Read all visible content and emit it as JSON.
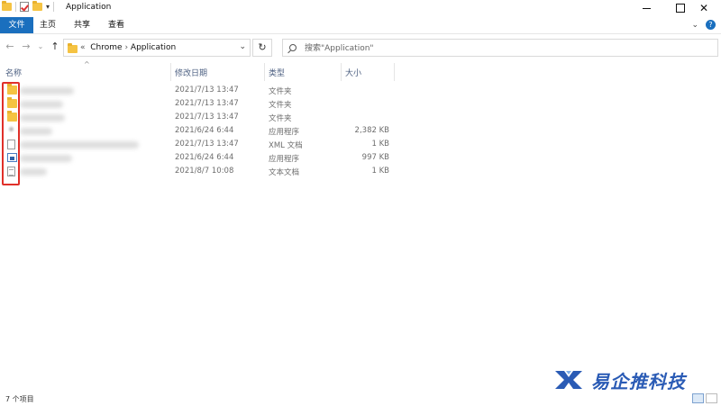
{
  "window": {
    "title": "Application"
  },
  "ribbon": {
    "tabs": [
      "文件",
      "主页",
      "共享",
      "查看"
    ]
  },
  "address_bar": {
    "prefix": "«",
    "crumbs": [
      "Chrome",
      "Application"
    ],
    "separator": "›"
  },
  "search": {
    "placeholder": "搜索\"Application\""
  },
  "columns": {
    "name": "名称",
    "date": "修改日期",
    "type": "类型",
    "size": "大小"
  },
  "files": [
    {
      "icon": "folder-icon",
      "date": "2021/7/13 13:47",
      "type": "文件夹",
      "size": ""
    },
    {
      "icon": "folder-icon",
      "date": "2021/7/13 13:47",
      "type": "文件夹",
      "size": ""
    },
    {
      "icon": "folder-icon",
      "date": "2021/7/13 13:47",
      "type": "文件夹",
      "size": ""
    },
    {
      "icon": "application-icon",
      "date": "2021/6/24 6:44",
      "type": "应用程序",
      "size": "2,382 KB"
    },
    {
      "icon": "xml-document-icon",
      "date": "2021/7/13 13:47",
      "type": "XML 文档",
      "size": "1 KB"
    },
    {
      "icon": "application-icon",
      "date": "2021/6/24 6:44",
      "type": "应用程序",
      "size": "997 KB"
    },
    {
      "icon": "text-document-icon",
      "date": "2021/8/7 10:08",
      "type": "文本文档",
      "size": "1 KB"
    }
  ],
  "status": {
    "item_count": "7 个项目"
  },
  "watermark": {
    "text": "易企推科技"
  },
  "colors": {
    "accent": "#1a6fbe",
    "highlight": "#e0302a",
    "folder": "#f5c342"
  }
}
